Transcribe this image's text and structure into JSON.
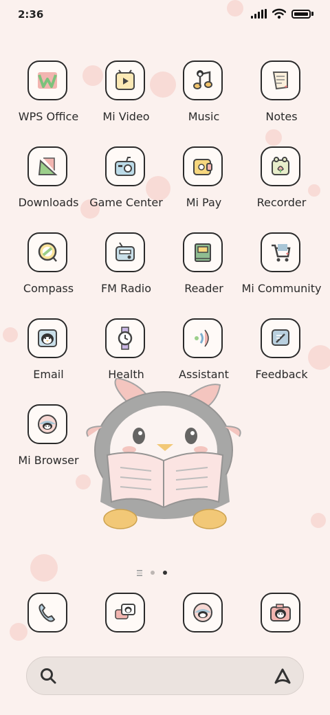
{
  "status_bar": {
    "time": "2:36"
  },
  "apps": [
    {
      "name": "WPS Office",
      "icon": "wps-office-icon"
    },
    {
      "name": "Mi Video",
      "icon": "video-icon"
    },
    {
      "name": "Music",
      "icon": "music-icon"
    },
    {
      "name": "Notes",
      "icon": "notes-icon"
    },
    {
      "name": "Downloads",
      "icon": "downloads-icon"
    },
    {
      "name": "Game Center",
      "icon": "game-center-icon"
    },
    {
      "name": "Mi Pay",
      "icon": "wallet-icon"
    },
    {
      "name": "Recorder",
      "icon": "recorder-icon"
    },
    {
      "name": "Compass",
      "icon": "compass-icon"
    },
    {
      "name": "FM Radio",
      "icon": "radio-icon"
    },
    {
      "name": "Reader",
      "icon": "book-icon"
    },
    {
      "name": "Mi Community",
      "icon": "community-icon"
    },
    {
      "name": "Email",
      "icon": "email-icon"
    },
    {
      "name": "Health",
      "icon": "watch-icon"
    },
    {
      "name": "Assistant",
      "icon": "assistant-icon"
    },
    {
      "name": "Feedback",
      "icon": "feedback-icon"
    },
    {
      "name": "Mi Browser",
      "icon": "browser-icon"
    }
  ],
  "dock": [
    {
      "icon": "phone-icon"
    },
    {
      "icon": "messages-icon"
    },
    {
      "icon": "browser-icon"
    },
    {
      "icon": "camera-icon"
    }
  ],
  "pager": {
    "pages": 2,
    "active_page": 2
  },
  "search_bar": {
    "left_icon": "search-icon",
    "right_icon": "assistant-a-icon"
  },
  "colors": {
    "background": "#fbf1ee",
    "tile_border": "#2a2a2a",
    "accent_pink": "#f2b5b0"
  }
}
